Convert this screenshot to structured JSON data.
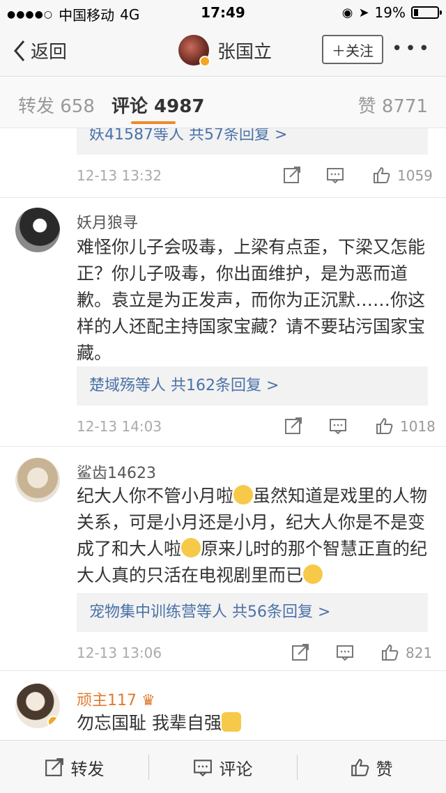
{
  "status_bar": {
    "carrier": "中国移动",
    "network": "4G",
    "time": "17:49",
    "battery": "19%",
    "battery_level": 0.19
  },
  "nav": {
    "back_label": "返回",
    "user_name": "张国立",
    "follow_label": "＋关注",
    "more_label": "•••"
  },
  "tabs": {
    "repost": "转发 658",
    "comment": "评论 4987",
    "like": "赞 8771"
  },
  "comments": [
    {
      "replies": "妖41587等人  共57条回复 >",
      "time": "12-13 13:32",
      "likes": "1059"
    },
    {
      "user": "妖月狼寻",
      "text": "难怪你儿子会吸毒，上梁有点歪，下梁又怎能正？你儿子吸毒，你出面维护，是为恶而道歉。袁立是为正发声，而你为正沉默……你这样的人还配主持国家宝藏？请不要玷污国家宝藏。",
      "replies": "楚域殇等人  共162条回复 >",
      "time": "12-13 14:03",
      "likes": "1018"
    },
    {
      "user": "鲨齿14623",
      "text_1": "纪大人你不管小月啦",
      "text_2": "虽然知道是戏里的人物关系，可是小月还是小月，纪大人你是不是变成了和大人啦",
      "text_3": "原来儿时的那个智慧正直的纪大人真的只活在电视剧里而已",
      "replies": "宠物集中训练营等人  共56条回复 >",
      "time": "12-13 13:06",
      "likes": "821"
    },
    {
      "user": "顽主117",
      "text": "勿忘国耻 我辈自强"
    }
  ],
  "bottom_bar": {
    "repost": "转发",
    "comment": "评论",
    "like": "赞"
  }
}
